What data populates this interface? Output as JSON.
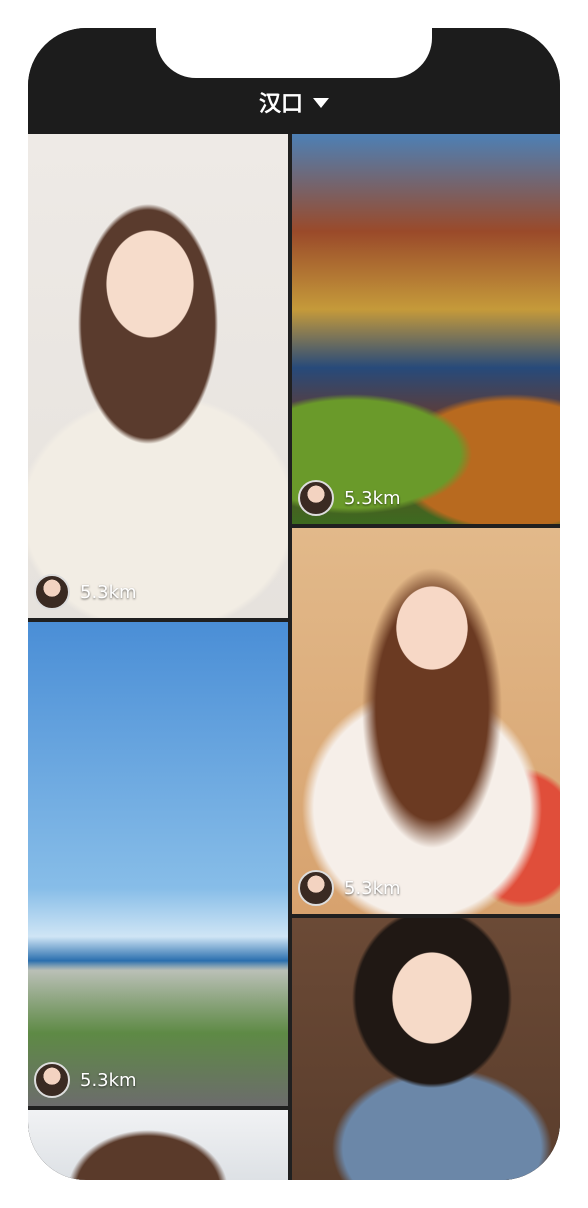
{
  "header": {
    "location": "汉口",
    "dropdown_icon": "triangle-down-icon"
  },
  "cards": [
    {
      "id": "card-1",
      "distance": "5.3km",
      "avatar_icon": "avatar"
    },
    {
      "id": "card-2",
      "distance": "5.3km",
      "avatar_icon": "avatar"
    },
    {
      "id": "card-3",
      "distance": "5.3km",
      "avatar_icon": "avatar"
    },
    {
      "id": "card-4",
      "distance": "5.3km",
      "avatar_icon": "avatar"
    },
    {
      "id": "card-5",
      "distance": "",
      "avatar_icon": ""
    },
    {
      "id": "card-6",
      "distance": "",
      "avatar_icon": ""
    }
  ]
}
